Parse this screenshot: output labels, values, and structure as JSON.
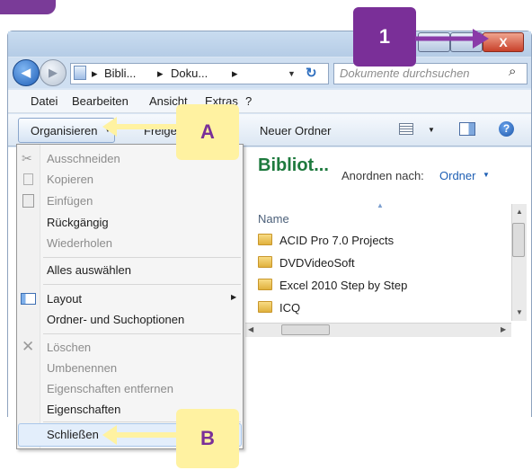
{
  "window": {
    "close_glyph": "X",
    "nav_back_glyph": "◀",
    "nav_fwd_glyph": "▶",
    "breadcrumb": [
      "Bibli...",
      "Doku..."
    ],
    "breadcrumb_arrow": "▸",
    "search_placeholder": "Dokumente durchsuchen"
  },
  "menubar": [
    "Datei",
    "Bearbeiten",
    "Ansicht",
    "Extras",
    "?"
  ],
  "commandbar": {
    "organize": "Organisieren",
    "share": "Freigeben",
    "new_folder": "Neuer Ordner"
  },
  "library": {
    "title": "Bibliot...",
    "arrange_label": "Anordnen nach:",
    "arrange_value": "Ordner",
    "column_name": "Name",
    "files": [
      "ACID Pro 7.0 Projects",
      "DVDVideoSoft",
      "Excel 2010 Step by Step",
      "ICQ"
    ]
  },
  "menu": {
    "cut": "Ausschneiden",
    "copy": "Kopieren",
    "paste": "Einfügen",
    "undo": "Rückgängig",
    "redo": "Wiederholen",
    "select_all": "Alles auswählen",
    "layout": "Layout",
    "folder_options": "Ordner- und Suchoptionen",
    "delete": "Löschen",
    "rename": "Umbenennen",
    "remove_properties": "Eigenschaften entfernen",
    "properties": "Eigenschaften",
    "close": "Schließen"
  },
  "callouts": {
    "step1": "1",
    "A": "A",
    "B": "B"
  },
  "colors": {
    "callout_purple": "#7a2f98",
    "callout_yellow": "#fff2a1",
    "link_blue": "#1e5fb4",
    "title_green": "#1e7a3e"
  }
}
